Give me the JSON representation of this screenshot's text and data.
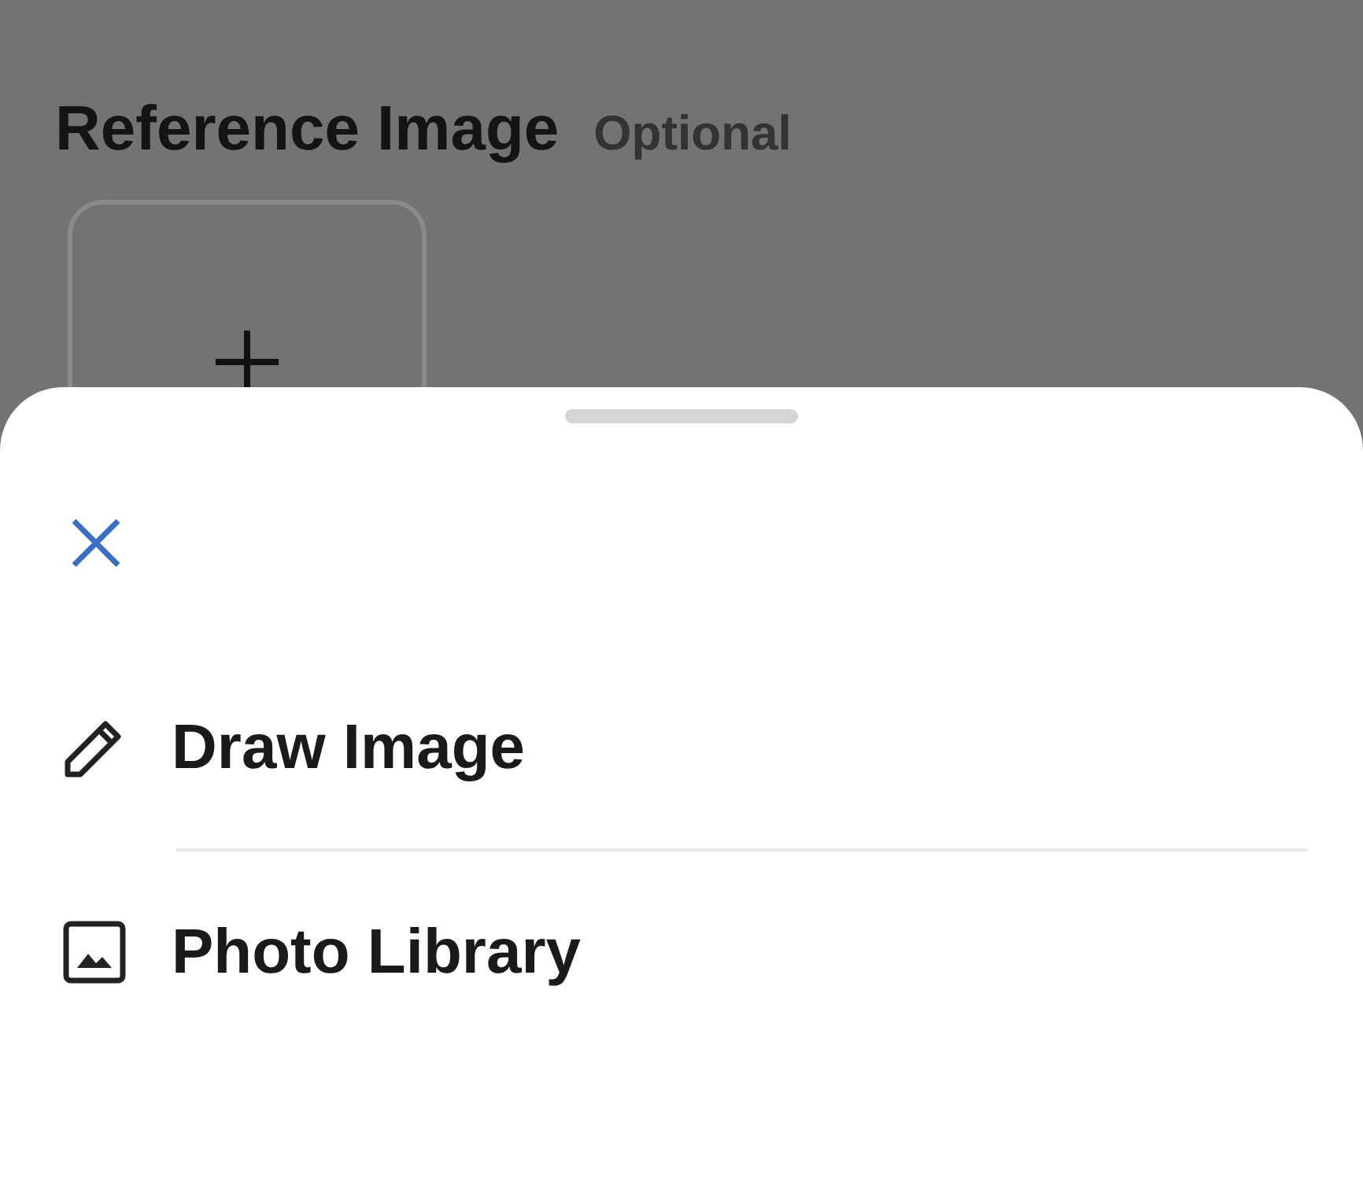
{
  "section": {
    "title": "Reference Image",
    "badge": "Optional"
  },
  "options": [
    {
      "kind": "draw",
      "label": "Draw Image"
    },
    {
      "kind": "photo",
      "label": "Photo Library"
    }
  ]
}
